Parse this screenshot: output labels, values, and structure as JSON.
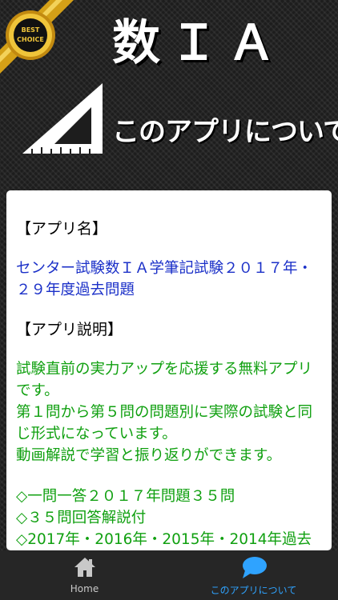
{
  "header": {
    "badge_line1": "BEST",
    "badge_line2": "CHOICE",
    "title": "数ＩＡ",
    "subtitle": "このアプリについて"
  },
  "card": {
    "app_name_heading": "【アプリ名】",
    "app_name": "センター試験数ＩＡ学筆記試験２０１７年・２９年度過去問題",
    "app_desc_heading": "【アプリ説明】",
    "app_desc": [
      "試験直前の実力アップを応援する無料アプリです。",
      "第１問から第５問の問題別に実際の試験と同じ形式になっています。",
      "動画解説で学習と振り返りができます。"
    ],
    "features": [
      "◇一問一答２０１７年問題３５問",
      "◇３５問回答解説付",
      "◇2017年・2016年・2015年・2014年過去"
    ]
  },
  "nav": {
    "home_label": "Home",
    "about_label": "このアプリについて"
  },
  "colors": {
    "background": "#1d1d1d",
    "accent_blue": "#1b30c8",
    "accent_green": "#10a010",
    "nav_active": "#2fa3ff",
    "badge_gold": "#d4a017"
  }
}
